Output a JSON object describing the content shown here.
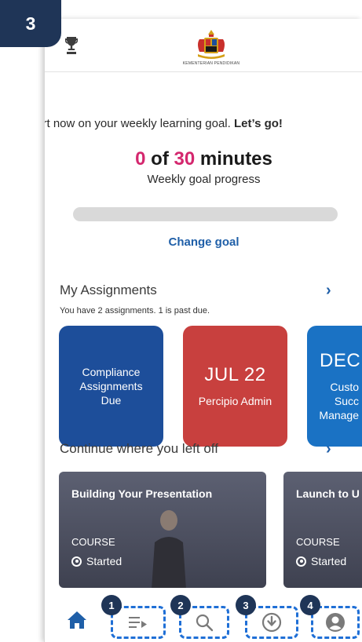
{
  "tutorial": {
    "step_number": "3"
  },
  "header": {
    "crest_caption": "KEMENTERIAN PENDIDIKAN"
  },
  "goal": {
    "prompt": "Start now on your weekly learning goal.",
    "prompt_cta": "Let’s go!",
    "current": "0",
    "of": "of",
    "target": "30",
    "unit": "minutes",
    "subtitle": "Weekly goal progress",
    "progress_fraction": 0,
    "change_label": "Change goal"
  },
  "assignments": {
    "title": "My Assignments",
    "more": "›",
    "summary": "You have 2 assignments. 1 is past due.",
    "cards": [
      {
        "date": "",
        "label": "Compliance Assignments Due",
        "color": "#1d4e9a"
      },
      {
        "date": "JUL 22",
        "label": "Percipio Admin",
        "color": "#c8403e"
      },
      {
        "date": "DEC",
        "label": "Custo Succ Manage",
        "color": "#1a72c4"
      }
    ]
  },
  "continue": {
    "title": "Continue where you left off",
    "more": "›",
    "courses": [
      {
        "title": "Building Your Presentation",
        "type": "COURSE",
        "status": "Started"
      },
      {
        "title": "Launch to U",
        "type": "COURSE",
        "status": "Started"
      }
    ]
  },
  "nav": {
    "callouts": [
      "1",
      "2",
      "3",
      "4"
    ],
    "items": [
      "home-icon",
      "playlist-icon",
      "search-icon",
      "download-icon",
      "profile-icon"
    ],
    "accent": "#1f6fd6"
  },
  "colors": {
    "brand_blue": "#1f5fa8",
    "accent_pink": "#d4276e",
    "callout_navy": "#1f3557"
  }
}
